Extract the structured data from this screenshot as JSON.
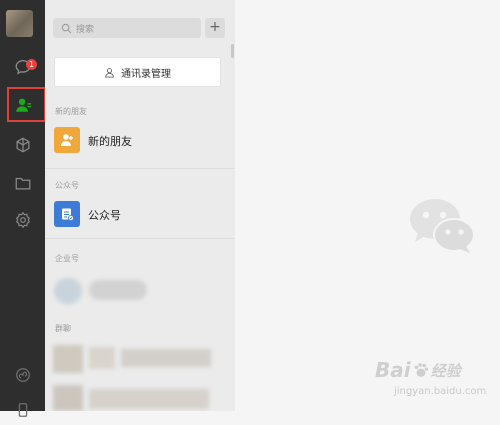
{
  "sidebar": {
    "badge_count": "1"
  },
  "contacts": {
    "search_placeholder": "搜索",
    "add_label": "+",
    "manage_label": "通讯录管理",
    "section_new_friends": "新的朋友",
    "new_friends_label": "新的朋友",
    "section_official": "公众号",
    "official_label": "公众号",
    "section_enterprise": "企业号",
    "section_groups": "群聊"
  },
  "watermark": {
    "text_left": "Bai",
    "text_right": "经验",
    "sub": "jingyan.baidu.com"
  },
  "colors": {
    "sidebar": "#2e2e2e",
    "accent_green": "#1aad19",
    "highlight": "#e0403a",
    "new_friend_icon": "#f0a83c",
    "official_icon": "#3d7bd6"
  }
}
